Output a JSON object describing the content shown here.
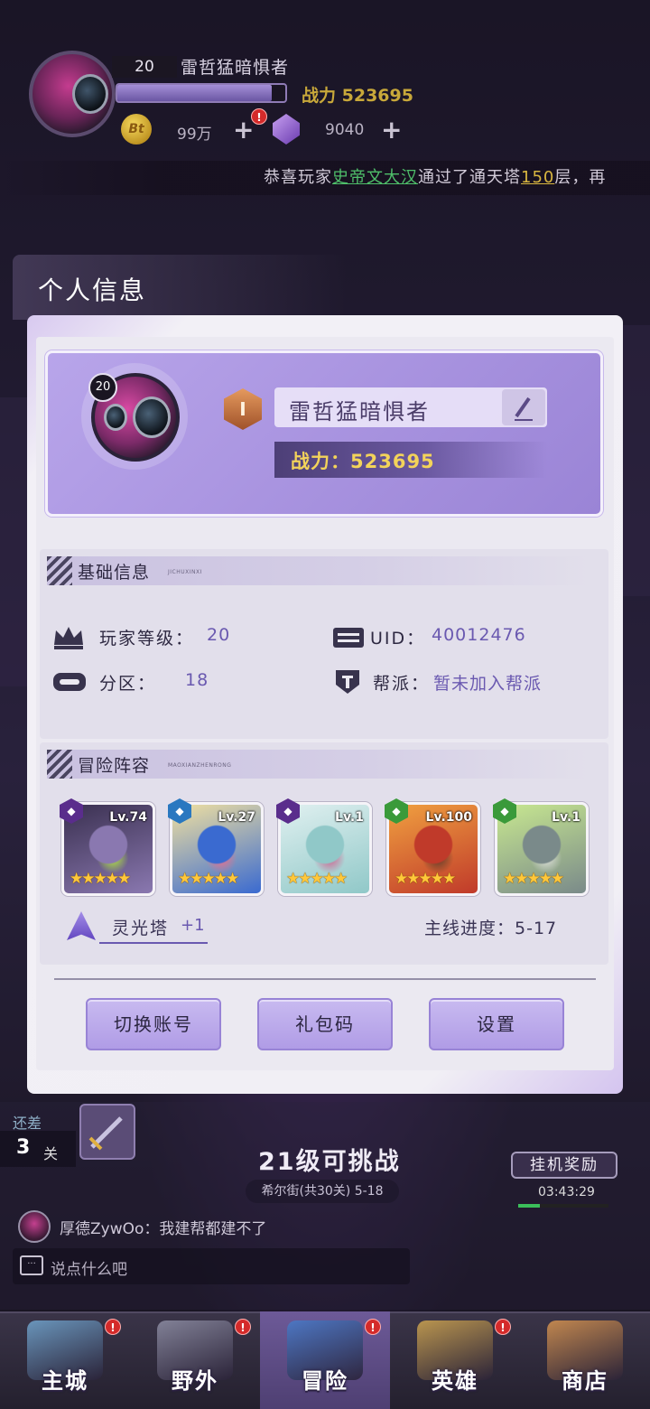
{
  "hud": {
    "level": "20",
    "player_name": "雷哲猛暗惧者",
    "power_label": "战力",
    "power_value": "523695",
    "coin_symbol": "Bt",
    "coins": "99万",
    "gems": "9040",
    "marquee": {
      "prefix": "恭喜玩家",
      "player": "史帝文大汉",
      "middle": "通过了通天塔",
      "floor": "150",
      "suffix": "层，再"
    }
  },
  "panel": {
    "title": "个人信息",
    "profile": {
      "level": "20",
      "medal": "I",
      "name": "雷哲猛暗惧者",
      "power_line": "战力：523695"
    },
    "basic": {
      "title": "基础信息",
      "subtitle": "JICHUXINXI",
      "player_level_label": "玩家等级：",
      "player_level_value": "20",
      "uid_label": "UID：",
      "uid_value": "40012476",
      "server_label": "分区：",
      "server_value": "18",
      "guild_label": "帮派：",
      "guild_value": "暂未加入帮派"
    },
    "lineup": {
      "title": "冒险阵容",
      "subtitle": "MAOXIANZHENRONG",
      "heroes": [
        {
          "level": "Lv.74",
          "stars": "★★★★★",
          "faction_color": "#5a2d8c",
          "art_colors": [
            "#3a3050",
            "#8a78b0",
            "#b6f03c"
          ]
        },
        {
          "level": "Lv.27",
          "stars": "★★★★★",
          "faction_color": "#2a78c0",
          "art_colors": [
            "#f0e0a0",
            "#3a6ad0",
            "#f06a8a"
          ]
        },
        {
          "level": "Lv.1",
          "stars": "★★★★★",
          "faction_color": "#5a2d8c",
          "art_colors": [
            "#e0f0f0",
            "#90c8c8",
            "#d05a8a"
          ]
        },
        {
          "level": "Lv.100",
          "stars": "★★★★★",
          "faction_color": "#3a9a3a",
          "art_colors": [
            "#f0a040",
            "#c03a2a",
            "#5a3a2a"
          ]
        },
        {
          "level": "Lv.1",
          "stars": "★★★★★",
          "faction_color": "#3a9a3a",
          "art_colors": [
            "#c8e890",
            "#7a8a8a",
            "#e0e0e0"
          ]
        }
      ],
      "tower_label": "灵光塔",
      "tower_value": "+1",
      "mainline_label": "主线进度：",
      "mainline_value": "5-17"
    },
    "buttons": {
      "switch_account": "切换账号",
      "gift_code": "礼包码",
      "settings": "设置"
    }
  },
  "game": {
    "gap_label": "还差",
    "gap_count": "3",
    "gap_unit": "关",
    "stage_title": "21级可挑战",
    "stage_sub": "希尔街(共30关) 5-18",
    "idle_label": "挂机奖励",
    "idle_time": "03:43:29",
    "idle_progress": 0.24,
    "chat_message": "厚德ZywOo：我建帮都建不了",
    "chat_placeholder": "说点什么吧"
  },
  "nav": [
    {
      "label": "主城",
      "badge": "!",
      "art": "#6fa0c8"
    },
    {
      "label": "野外",
      "badge": "!",
      "art": "#8a8aa0"
    },
    {
      "label": "冒险",
      "badge": "!",
      "art": "#4a7ac8"
    },
    {
      "label": "英雄",
      "badge": "!",
      "art": "#c8a050"
    },
    {
      "label": "商店",
      "badge": "",
      "art": "#d09050"
    }
  ],
  "colors": {
    "accent": "#6a59b0",
    "gold": "#f3d35a",
    "alert": "#d42a2a"
  }
}
